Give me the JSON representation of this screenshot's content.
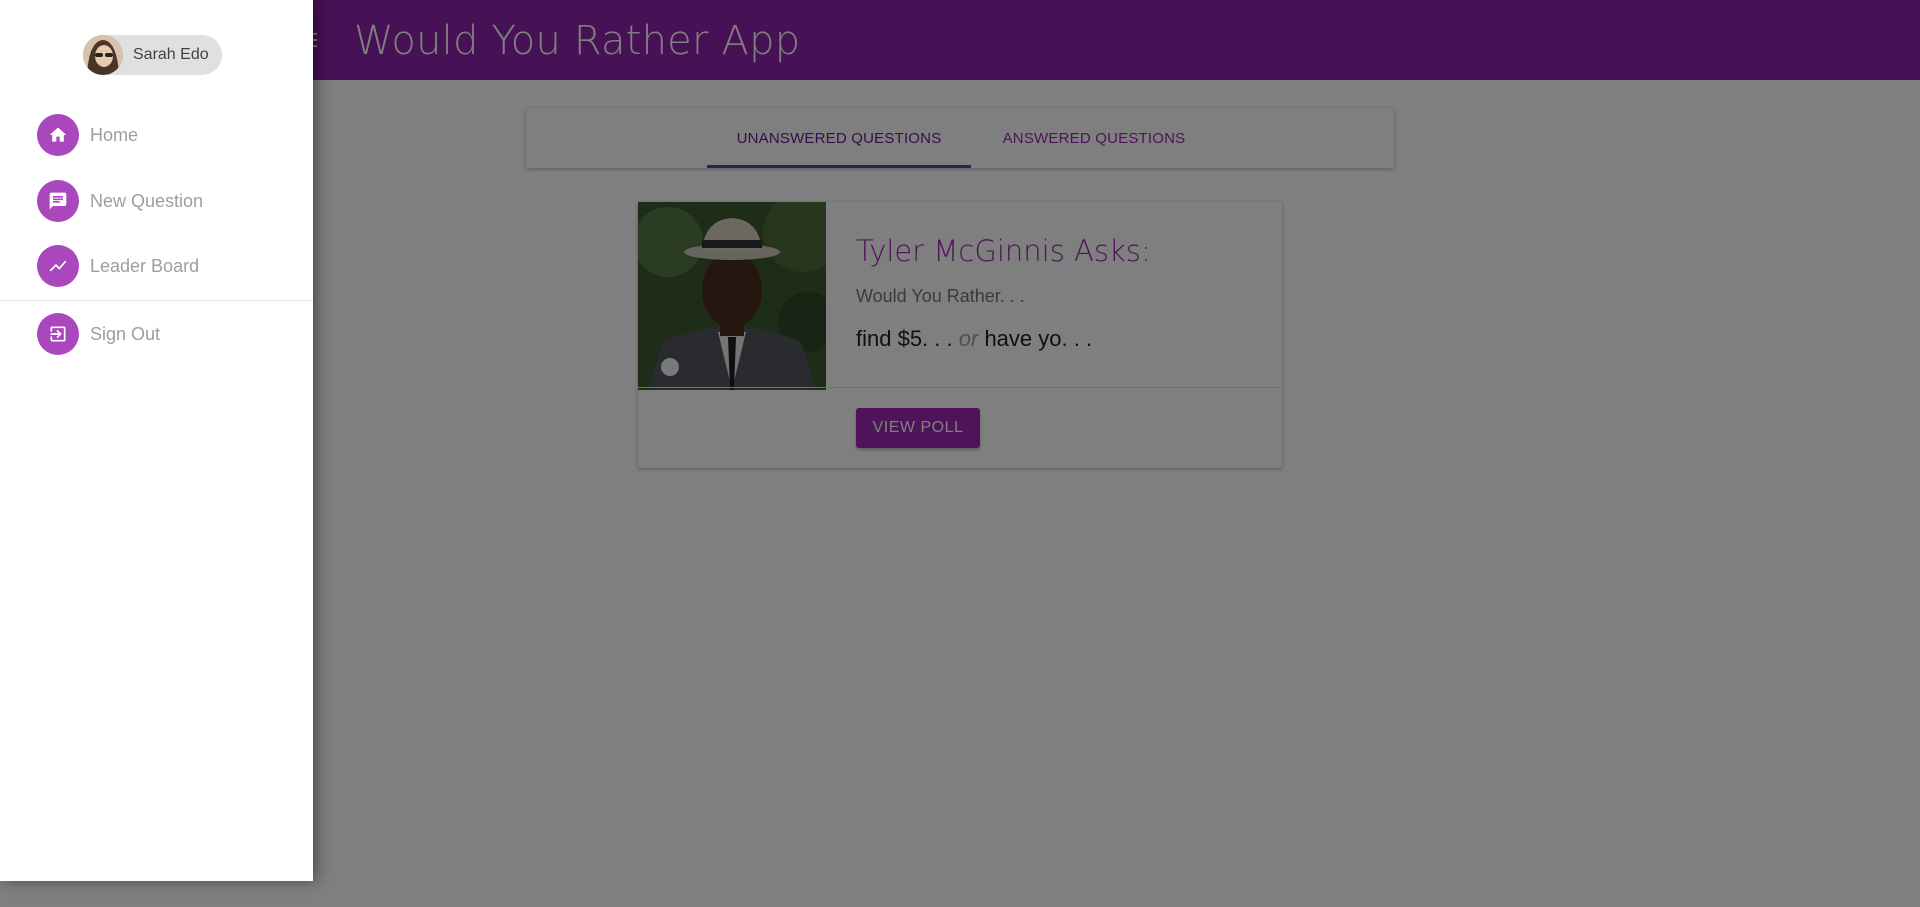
{
  "app": {
    "title": "Would You Rather App"
  },
  "tabs": [
    {
      "label": "Unanswered Questions",
      "selected": true
    },
    {
      "label": "Answered Questions",
      "selected": false
    }
  ],
  "question_card": {
    "title": "Tyler McGinnis Asks:",
    "subtitle": "Would You Rather. . .",
    "option_one": "find $5. . .",
    "or_text": "or",
    "option_two": "have yo. . .",
    "button_label": "View Poll"
  },
  "drawer": {
    "user": {
      "name": "Sarah Edo"
    },
    "items": [
      {
        "label": "Home",
        "icon": "home-icon"
      },
      {
        "label": "New Question",
        "icon": "chat-icon"
      },
      {
        "label": "Leader Board",
        "icon": "trending-up-icon"
      },
      {
        "label": "Sign Out",
        "icon": "exit-icon"
      }
    ]
  },
  "colors": {
    "primary": "#8e24aa",
    "accent": "#9c27b0",
    "drawer_icon_bg": "#ab47bc",
    "tab_indicator": "#3f51b5"
  }
}
